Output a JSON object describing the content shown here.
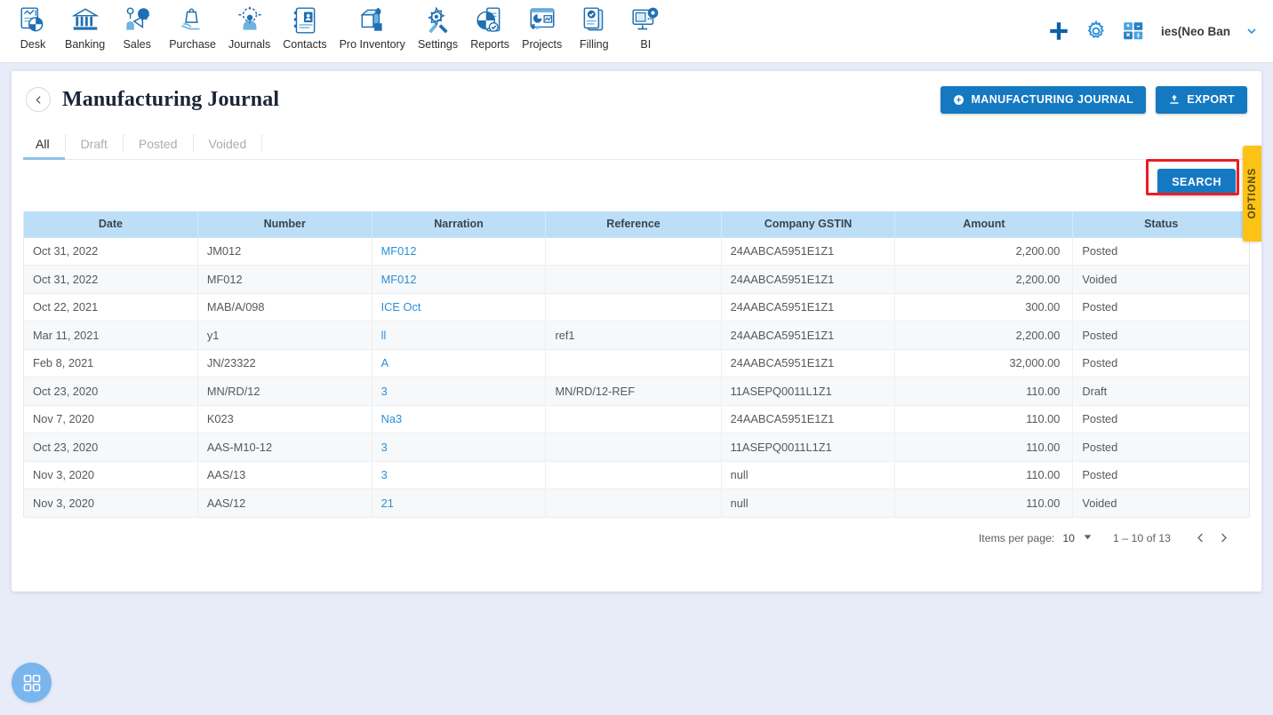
{
  "topnav": {
    "items": [
      {
        "label": "Desk",
        "icon": "desk-dashboard-icon"
      },
      {
        "label": "Banking",
        "icon": "bank-building-icon"
      },
      {
        "label": "Sales",
        "icon": "sales-megaphone-icon"
      },
      {
        "label": "Purchase",
        "icon": "purchase-bag-hand-icon"
      },
      {
        "label": "Journals",
        "icon": "journals-people-gear-icon"
      },
      {
        "label": "Contacts",
        "icon": "contacts-book-icon"
      },
      {
        "label": "Pro Inventory",
        "icon": "inventory-boxes-icon"
      },
      {
        "label": "Settings",
        "icon": "settings-gear-wrench-icon"
      },
      {
        "label": "Reports",
        "icon": "reports-piechart-icon"
      },
      {
        "label": "Projects",
        "icon": "projects-board-icon"
      },
      {
        "label": "Filling",
        "icon": "filling-documents-check-icon"
      },
      {
        "label": "BI",
        "icon": "bi-monitor-gear-icon"
      }
    ],
    "actions": [
      {
        "name": "add-new-button",
        "icon": "plus-icon"
      },
      {
        "name": "settings-button",
        "icon": "gear-icon"
      },
      {
        "name": "calculator-button",
        "icon": "calculator-icon"
      }
    ],
    "company": "ies(Neo Ban",
    "company_caret": "chevron-down-icon"
  },
  "page": {
    "title": "Manufacturing Journal",
    "back_icon": "chevron-left-icon",
    "buttons": {
      "create": "MANUFACTURING JOURNAL",
      "create_icon": "plus-circle-icon",
      "export": "EXPORT",
      "export_icon": "upload-icon"
    },
    "options_tab": "OPTIONS",
    "search_button": "SEARCH"
  },
  "tabs": [
    {
      "label": "All",
      "active": true
    },
    {
      "label": "Draft",
      "active": false
    },
    {
      "label": "Posted",
      "active": false
    },
    {
      "label": "Voided",
      "active": false
    }
  ],
  "table": {
    "columns": [
      "Date",
      "Number",
      "Narration",
      "Reference",
      "Company GSTIN",
      "Amount",
      "Status"
    ],
    "rows": [
      {
        "date": "Oct 31, 2022",
        "number": "JM012",
        "narration": "MF012",
        "reference": "",
        "gstin": "24AABCA5951E1Z1",
        "amount": "2,200.00",
        "status": "Posted"
      },
      {
        "date": "Oct 31, 2022",
        "number": "MF012",
        "narration": "MF012",
        "reference": "",
        "gstin": "24AABCA5951E1Z1",
        "amount": "2,200.00",
        "status": "Voided"
      },
      {
        "date": "Oct 22, 2021",
        "number": "MAB/A/098",
        "narration": "ICE Oct",
        "reference": "",
        "gstin": "24AABCA5951E1Z1",
        "amount": "300.00",
        "status": "Posted"
      },
      {
        "date": "Mar 11, 2021",
        "number": "y1",
        "narration": "ll",
        "reference": "ref1",
        "gstin": "24AABCA5951E1Z1",
        "amount": "2,200.00",
        "status": "Posted"
      },
      {
        "date": "Feb 8, 2021",
        "number": "JN/23322",
        "narration": "A",
        "reference": "",
        "gstin": "24AABCA5951E1Z1",
        "amount": "32,000.00",
        "status": "Posted"
      },
      {
        "date": "Oct 23, 2020",
        "number": "MN/RD/12",
        "narration": "3",
        "reference": "MN/RD/12-REF",
        "gstin": "11ASEPQ0011L1Z1",
        "amount": "110.00",
        "status": "Draft"
      },
      {
        "date": "Nov 7, 2020",
        "number": "K023",
        "narration": "Na3",
        "reference": "",
        "gstin": "24AABCA5951E1Z1",
        "amount": "110.00",
        "status": "Posted"
      },
      {
        "date": "Oct 23, 2020",
        "number": "AAS-M10-12",
        "narration": "3",
        "reference": "",
        "gstin": "11ASEPQ0011L1Z1",
        "amount": "110.00",
        "status": "Posted"
      },
      {
        "date": "Nov 3, 2020",
        "number": "AAS/13",
        "narration": "3",
        "reference": "",
        "gstin": "null",
        "amount": "110.00",
        "status": "Posted"
      },
      {
        "date": "Nov 3, 2020",
        "number": "AAS/12",
        "narration": "21",
        "reference": "",
        "gstin": "null",
        "amount": "110.00",
        "status": "Voided"
      }
    ]
  },
  "paginator": {
    "items_per_page_label": "Items per page:",
    "items_per_page_value": "10",
    "range": "1 – 10 of 13",
    "prev_icon": "chevron-left-icon",
    "next_icon": "chevron-right-icon",
    "caret_icon": "caret-down-icon"
  },
  "fab": {
    "icon": "grid-apps-icon"
  },
  "colors": {
    "accent_blue": "#1579c2",
    "table_header": "#bcdff7",
    "link_blue": "#2a8fd8",
    "options_yellow": "#fcc216",
    "highlight_red": "#ee1c24",
    "page_background": "#e8ecf8"
  }
}
